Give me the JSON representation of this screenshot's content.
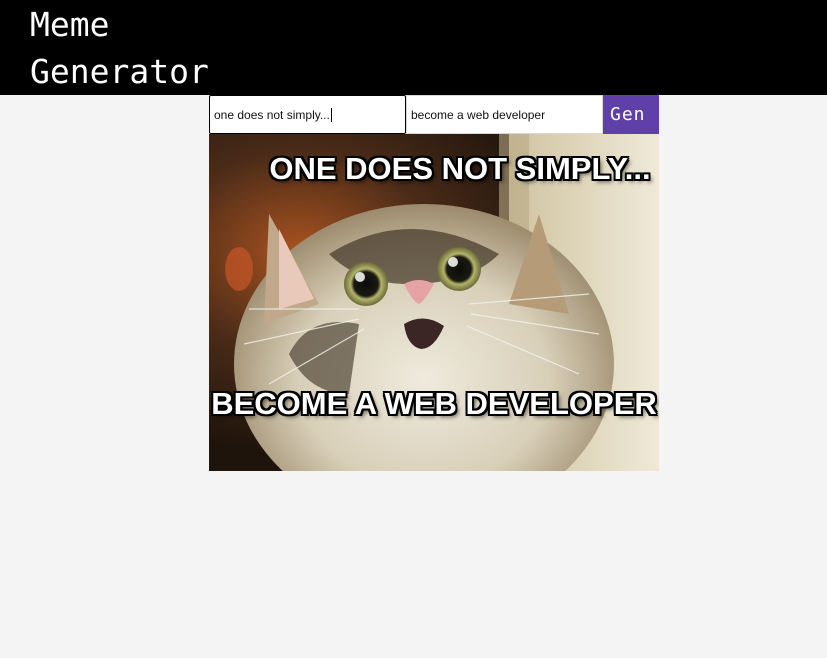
{
  "header": {
    "title": "Meme Generator"
  },
  "form": {
    "top_text_value": "one does not simply...",
    "bottom_text_value": "become a web developer",
    "generate_label": "Gen",
    "generate_color": "#5f40a8"
  },
  "meme": {
    "image_subject": "surprised-cat-photo",
    "top_caption": "ONE DOES NOT SIMPLY...",
    "bottom_caption": "BECOME A WEB DEVELOPER"
  }
}
